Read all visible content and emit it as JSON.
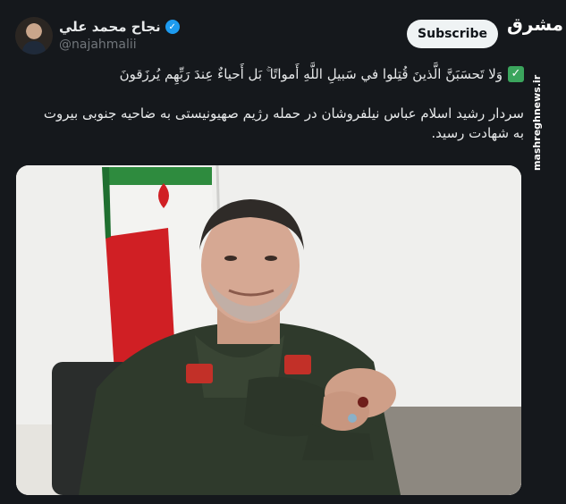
{
  "author": {
    "display_name": "نجاح محمد علي",
    "handle": "@najahmalii",
    "verified": true
  },
  "subscribe_label": "Subscribe",
  "watermark": {
    "logo_text": "مشرق",
    "site_url": "mashreghnews.ir"
  },
  "tweet": {
    "quote_line": "وَلا تَحسَبَنَّ الَّذينَ قُتِلوا في سَبيلِ اللَّهِ أَمواتًا ۚ بَل أَحياءٌ عِندَ رَبِّهِم يُرزَقونَ",
    "persian_text": "سردار رشید اسلام عباس نیلفروشان در حمله رژیم صهیونیستی به ضاحیه جنوبی بیروت به شهادت رسید."
  },
  "colors": {
    "background": "#15181c",
    "text": "#e7e9ea",
    "secondary_text": "#71767b",
    "verified_blue": "#1d9bf0",
    "check_green": "#3ba55d"
  },
  "icons": [
    "verified-badge-icon",
    "check-mark-icon"
  ]
}
